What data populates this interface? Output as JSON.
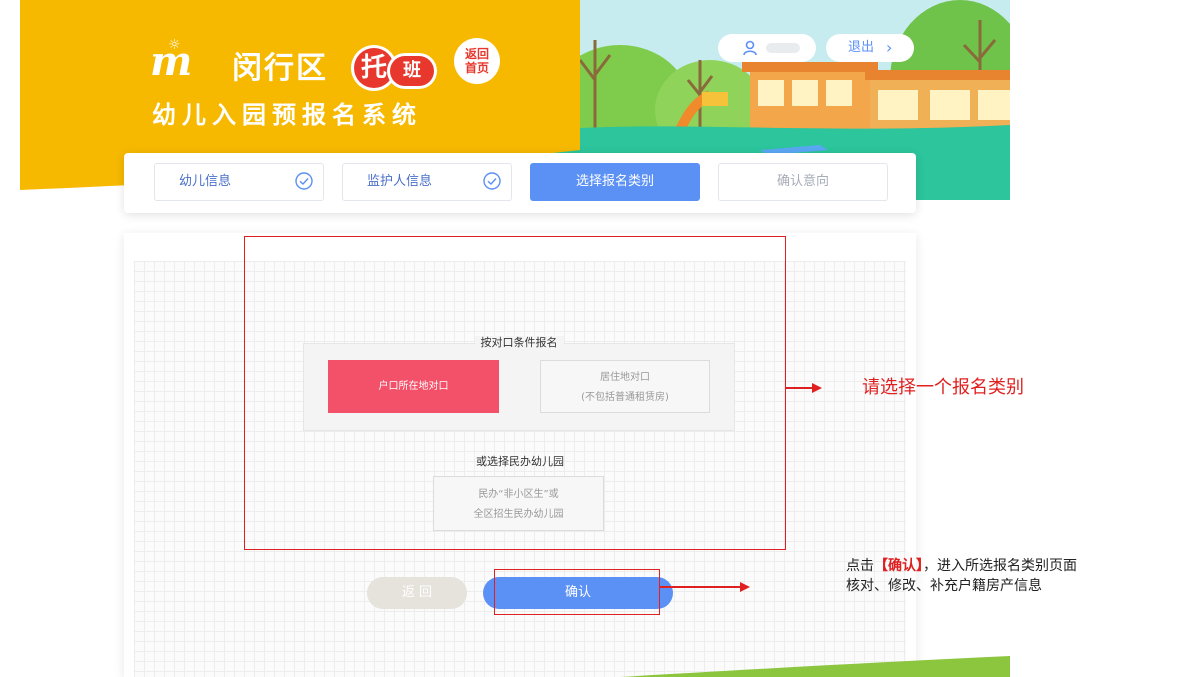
{
  "header": {
    "logo_letter": "m",
    "title_district": "闵行区",
    "title_tuo": "托",
    "title_ban": "班",
    "title_system": "幼儿入园预报名系统",
    "home_button": "返回首页",
    "user_name": "",
    "logout_label": "退出",
    "logout_chevron": "›"
  },
  "steps": [
    {
      "label": "幼儿信息",
      "state": "done"
    },
    {
      "label": "监护人信息",
      "state": "done"
    },
    {
      "label": "选择报名类别",
      "state": "active"
    },
    {
      "label": "确认意向",
      "state": "todo"
    }
  ],
  "form": {
    "category_title": "按对口条件报名",
    "option_household": "户口所在地对口",
    "option_residence_line1": "居住地对口",
    "option_residence_line2": "(不包括普通租赁房)",
    "private_title": "或选择民办幼儿园",
    "option_private_line1": "民办“非小区生”或",
    "option_private_line2": "全区招生民办幼儿园",
    "back_button": "返 回",
    "confirm_button": "确认"
  },
  "annotations": {
    "note1": "请选择一个报名类别",
    "note2_prefix": "点击",
    "note2_keyword": "【确认】",
    "note2_line1_rest": "，进入所选报名类别页面",
    "note2_line2": "核对、修改、补充户籍房产信息"
  },
  "colors": {
    "banner_yellow": "#f6b900",
    "accent_blue": "#5b90f5",
    "selected_red": "#f25169",
    "annotation_red": "#e02020",
    "grass_green": "#28c29a"
  },
  "icons": [
    "user-icon",
    "check-circle-icon",
    "chevron-right-icon",
    "sun-icon"
  ]
}
